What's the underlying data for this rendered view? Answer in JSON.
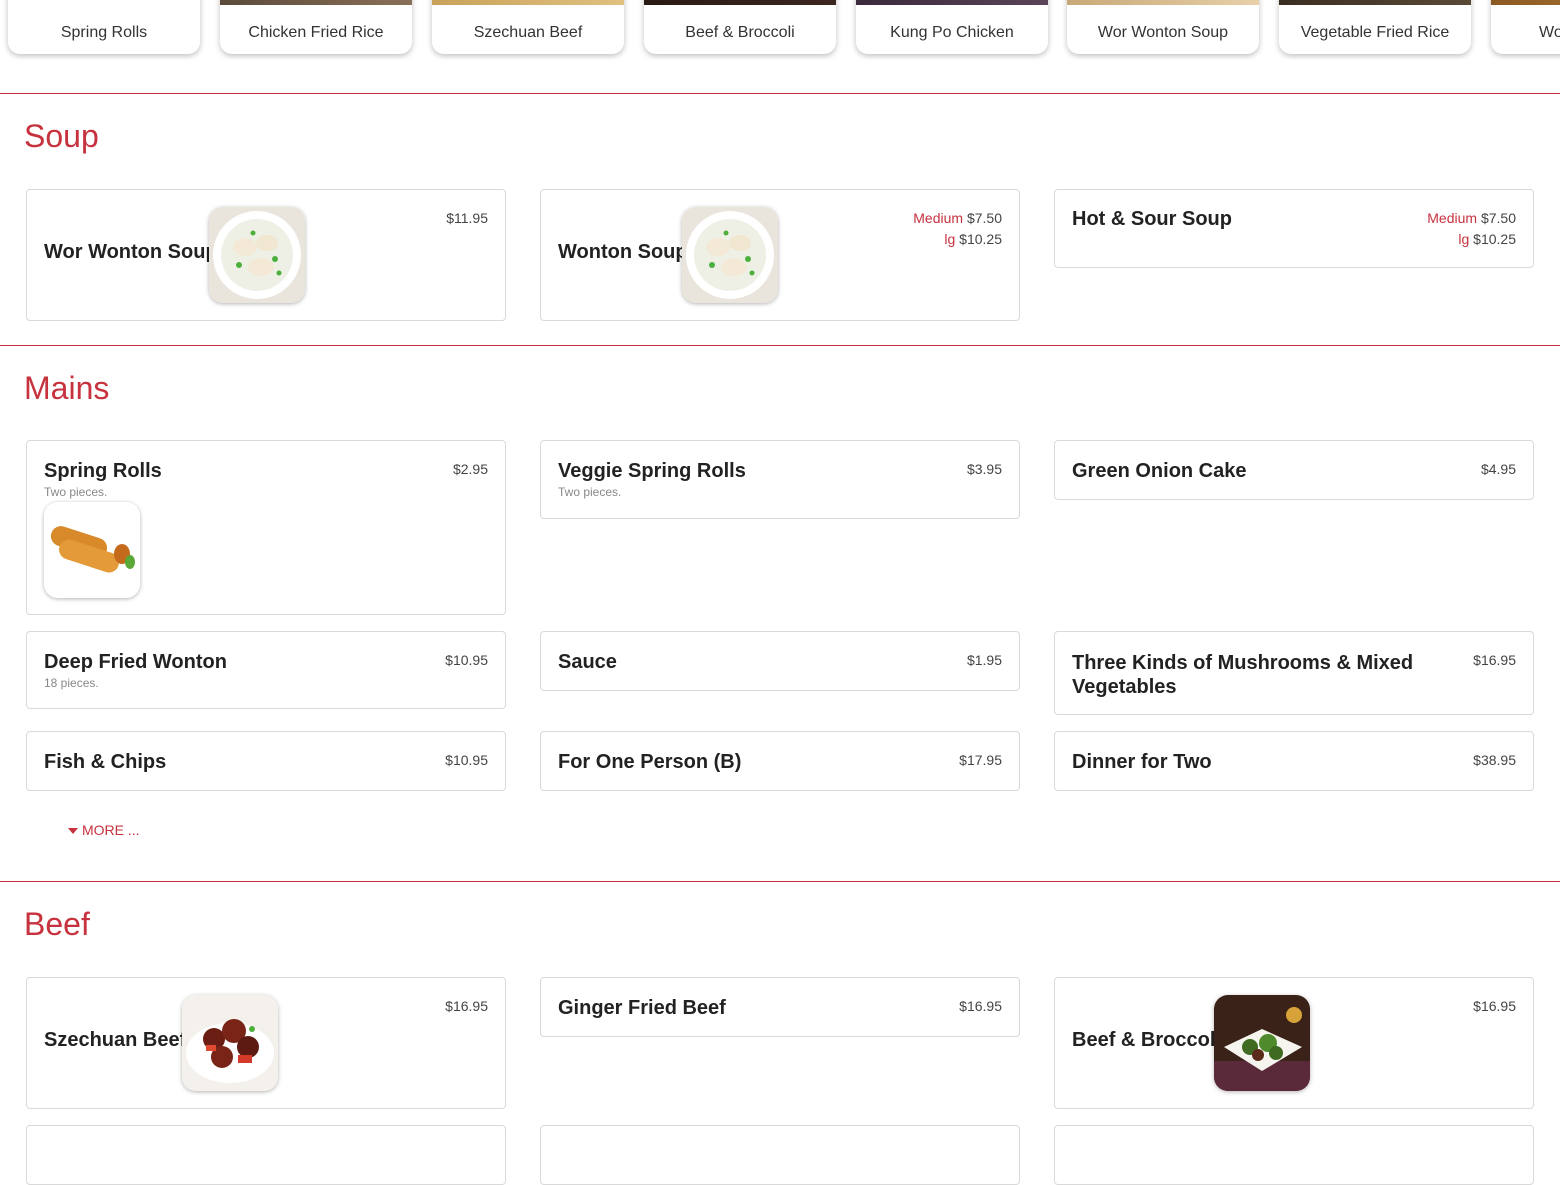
{
  "carousel": [
    {
      "label": "Spring Rolls"
    },
    {
      "label": "Chicken Fried Rice"
    },
    {
      "label": "Szechuan Beef"
    },
    {
      "label": "Beef & Broccoli"
    },
    {
      "label": "Kung Po Chicken"
    },
    {
      "label": "Wor Wonton Soup"
    },
    {
      "label": "Vegetable Fried Rice"
    },
    {
      "label": "Wo"
    }
  ],
  "sections": {
    "soup": {
      "title": "Soup",
      "items": [
        {
          "name": "Wor Wonton Soup",
          "price": "$11.95"
        },
        {
          "name": "Wonton Soup",
          "size1": "Medium",
          "price1": "$7.50",
          "size2": "lg",
          "price2": "$10.25"
        },
        {
          "name": "Hot & Sour Soup",
          "size1": "Medium",
          "price1": "$7.50",
          "size2": "lg",
          "price2": "$10.25"
        }
      ]
    },
    "mains": {
      "title": "Mains",
      "items": [
        {
          "name": "Spring Rolls",
          "price": "$2.95",
          "desc": "Two pieces."
        },
        {
          "name": "Veggie Spring Rolls",
          "price": "$3.95",
          "desc": "Two pieces."
        },
        {
          "name": "Green Onion Cake",
          "price": "$4.95"
        },
        {
          "name": "Deep Fried Wonton",
          "price": "$10.95",
          "desc": "18 pieces."
        },
        {
          "name": "Sauce",
          "price": "$1.95"
        },
        {
          "name": "Three Kinds of Mushrooms & Mixed Vegetables",
          "price": "$16.95"
        },
        {
          "name": "Fish & Chips",
          "price": "$10.95"
        },
        {
          "name": "For One Person (B)",
          "price": "$17.95"
        },
        {
          "name": "Dinner for Two",
          "price": "$38.95"
        }
      ],
      "more_label": "MORE ..."
    },
    "beef": {
      "title": "Beef",
      "items": [
        {
          "name": "Szechuan Beef",
          "price": "$16.95"
        },
        {
          "name": "Ginger Fried Beef",
          "price": "$16.95"
        },
        {
          "name": "Beef & Broccoli",
          "price": "$16.95"
        }
      ]
    }
  },
  "colors": {
    "accent": "#c6323e"
  }
}
